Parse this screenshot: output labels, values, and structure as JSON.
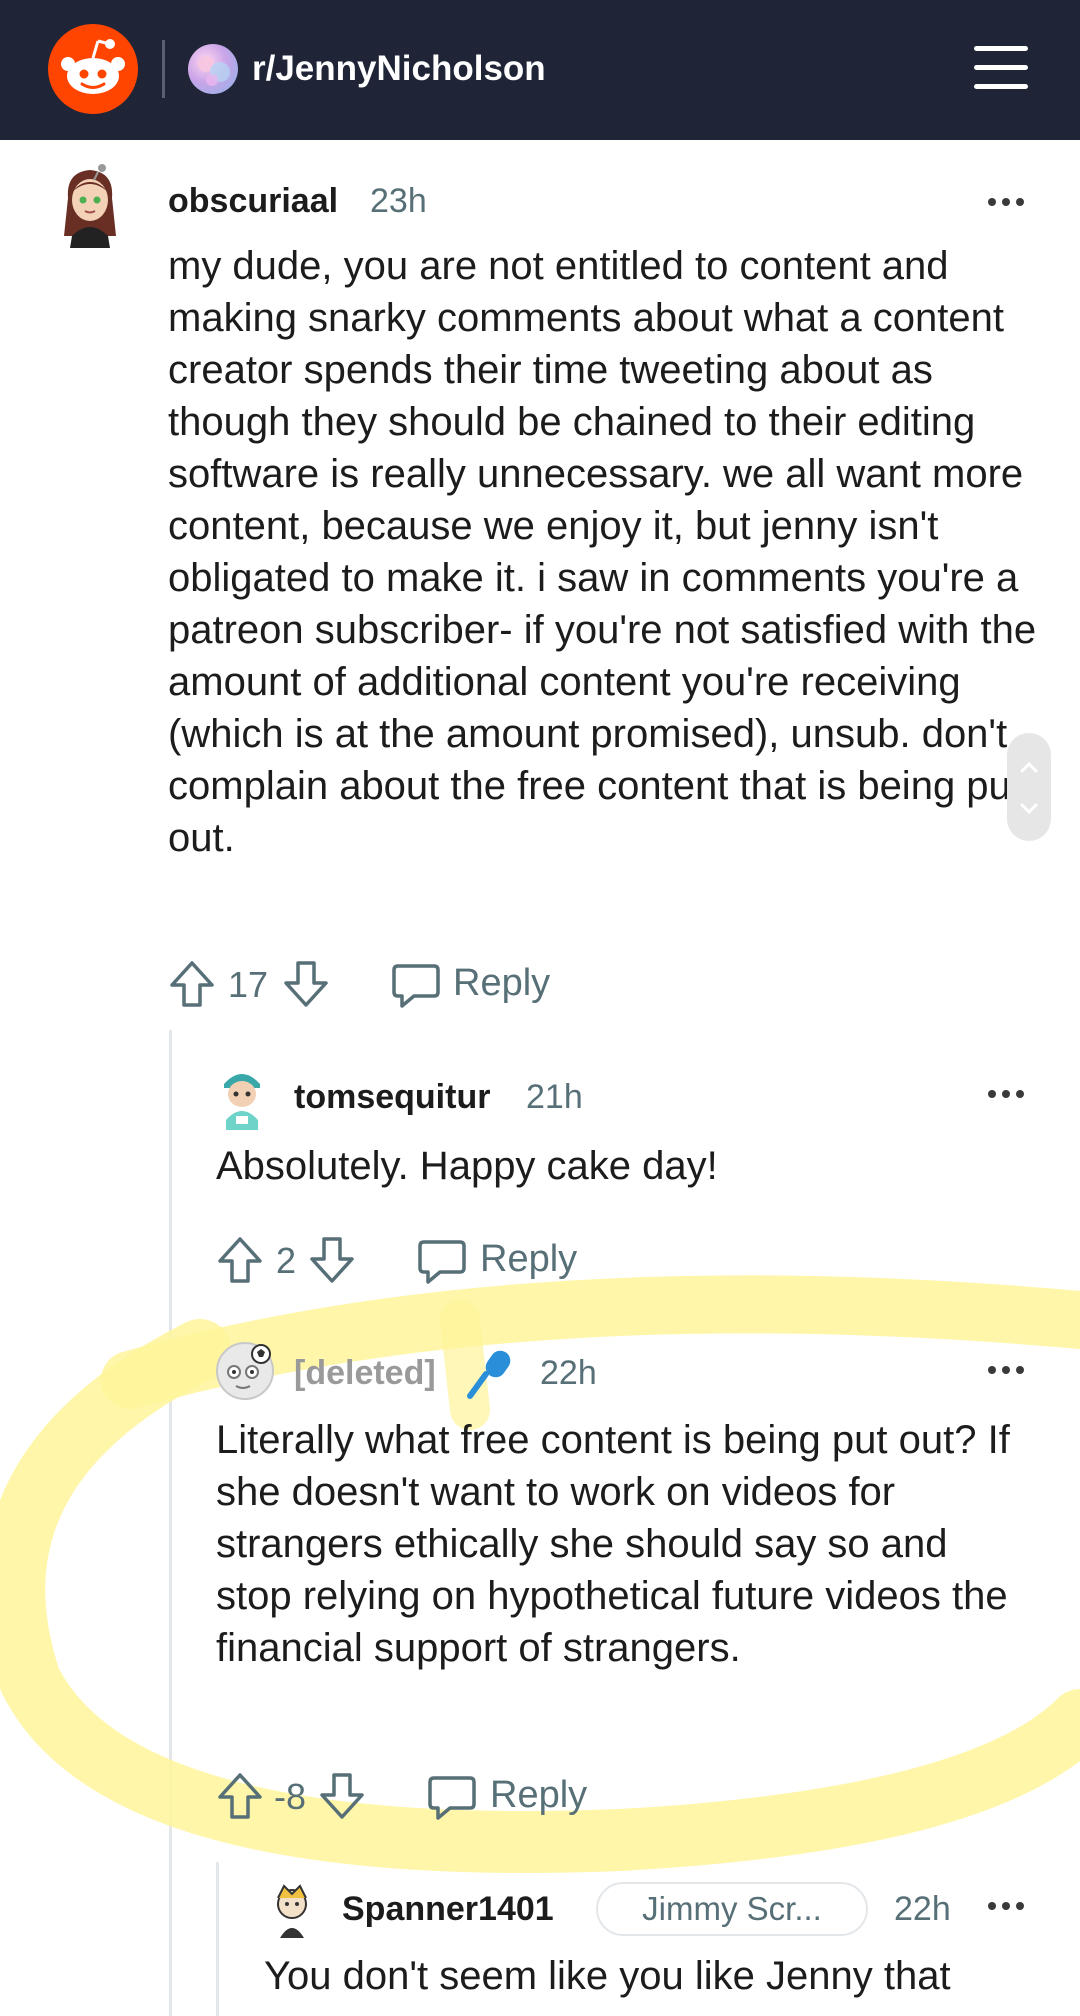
{
  "header": {
    "subreddit": "r/JennyNicholson",
    "logo_icon": "reddit-snoo-icon",
    "menu_icon": "hamburger-menu-icon",
    "background": "#1f2536",
    "brand_color": "#ff4500"
  },
  "comments": [
    {
      "username": "obscuriaal",
      "time": "23h",
      "body": "my dude, you are not entitled to content and making snarky comments about what a content creator spends their time tweeting about as though they should be chained to their editing software is really unnecessary. we all want more content, because we enjoy it, but jenny isn't obligated to make it. i saw in comments you're a patreon subscriber- if you're not satisfied with the amount of additional content you're receiving (which is at the amount promised), unsub. don't complain about the free content that is being put out.",
      "score": "17",
      "reply_label": "Reply"
    },
    {
      "username": "tomsequitur",
      "time": "21h",
      "body": "Absolutely. Happy cake day!",
      "score": "2",
      "reply_label": "Reply"
    },
    {
      "username": "[deleted]",
      "time": "22h",
      "body": "Literally what free content is being put out? If she doesn't want to work on videos for strangers ethically she should say so and stop relying on hypothetical future videos the financial support of strangers.",
      "score": "-8",
      "reply_label": "Reply",
      "badge_icon": "microphone-icon"
    },
    {
      "username": "Spanner1401",
      "flair": "Jimmy Scr...",
      "time": "22h",
      "body": "You don't seem like you like Jenny that"
    }
  ],
  "highlight_color": "#fff59a"
}
